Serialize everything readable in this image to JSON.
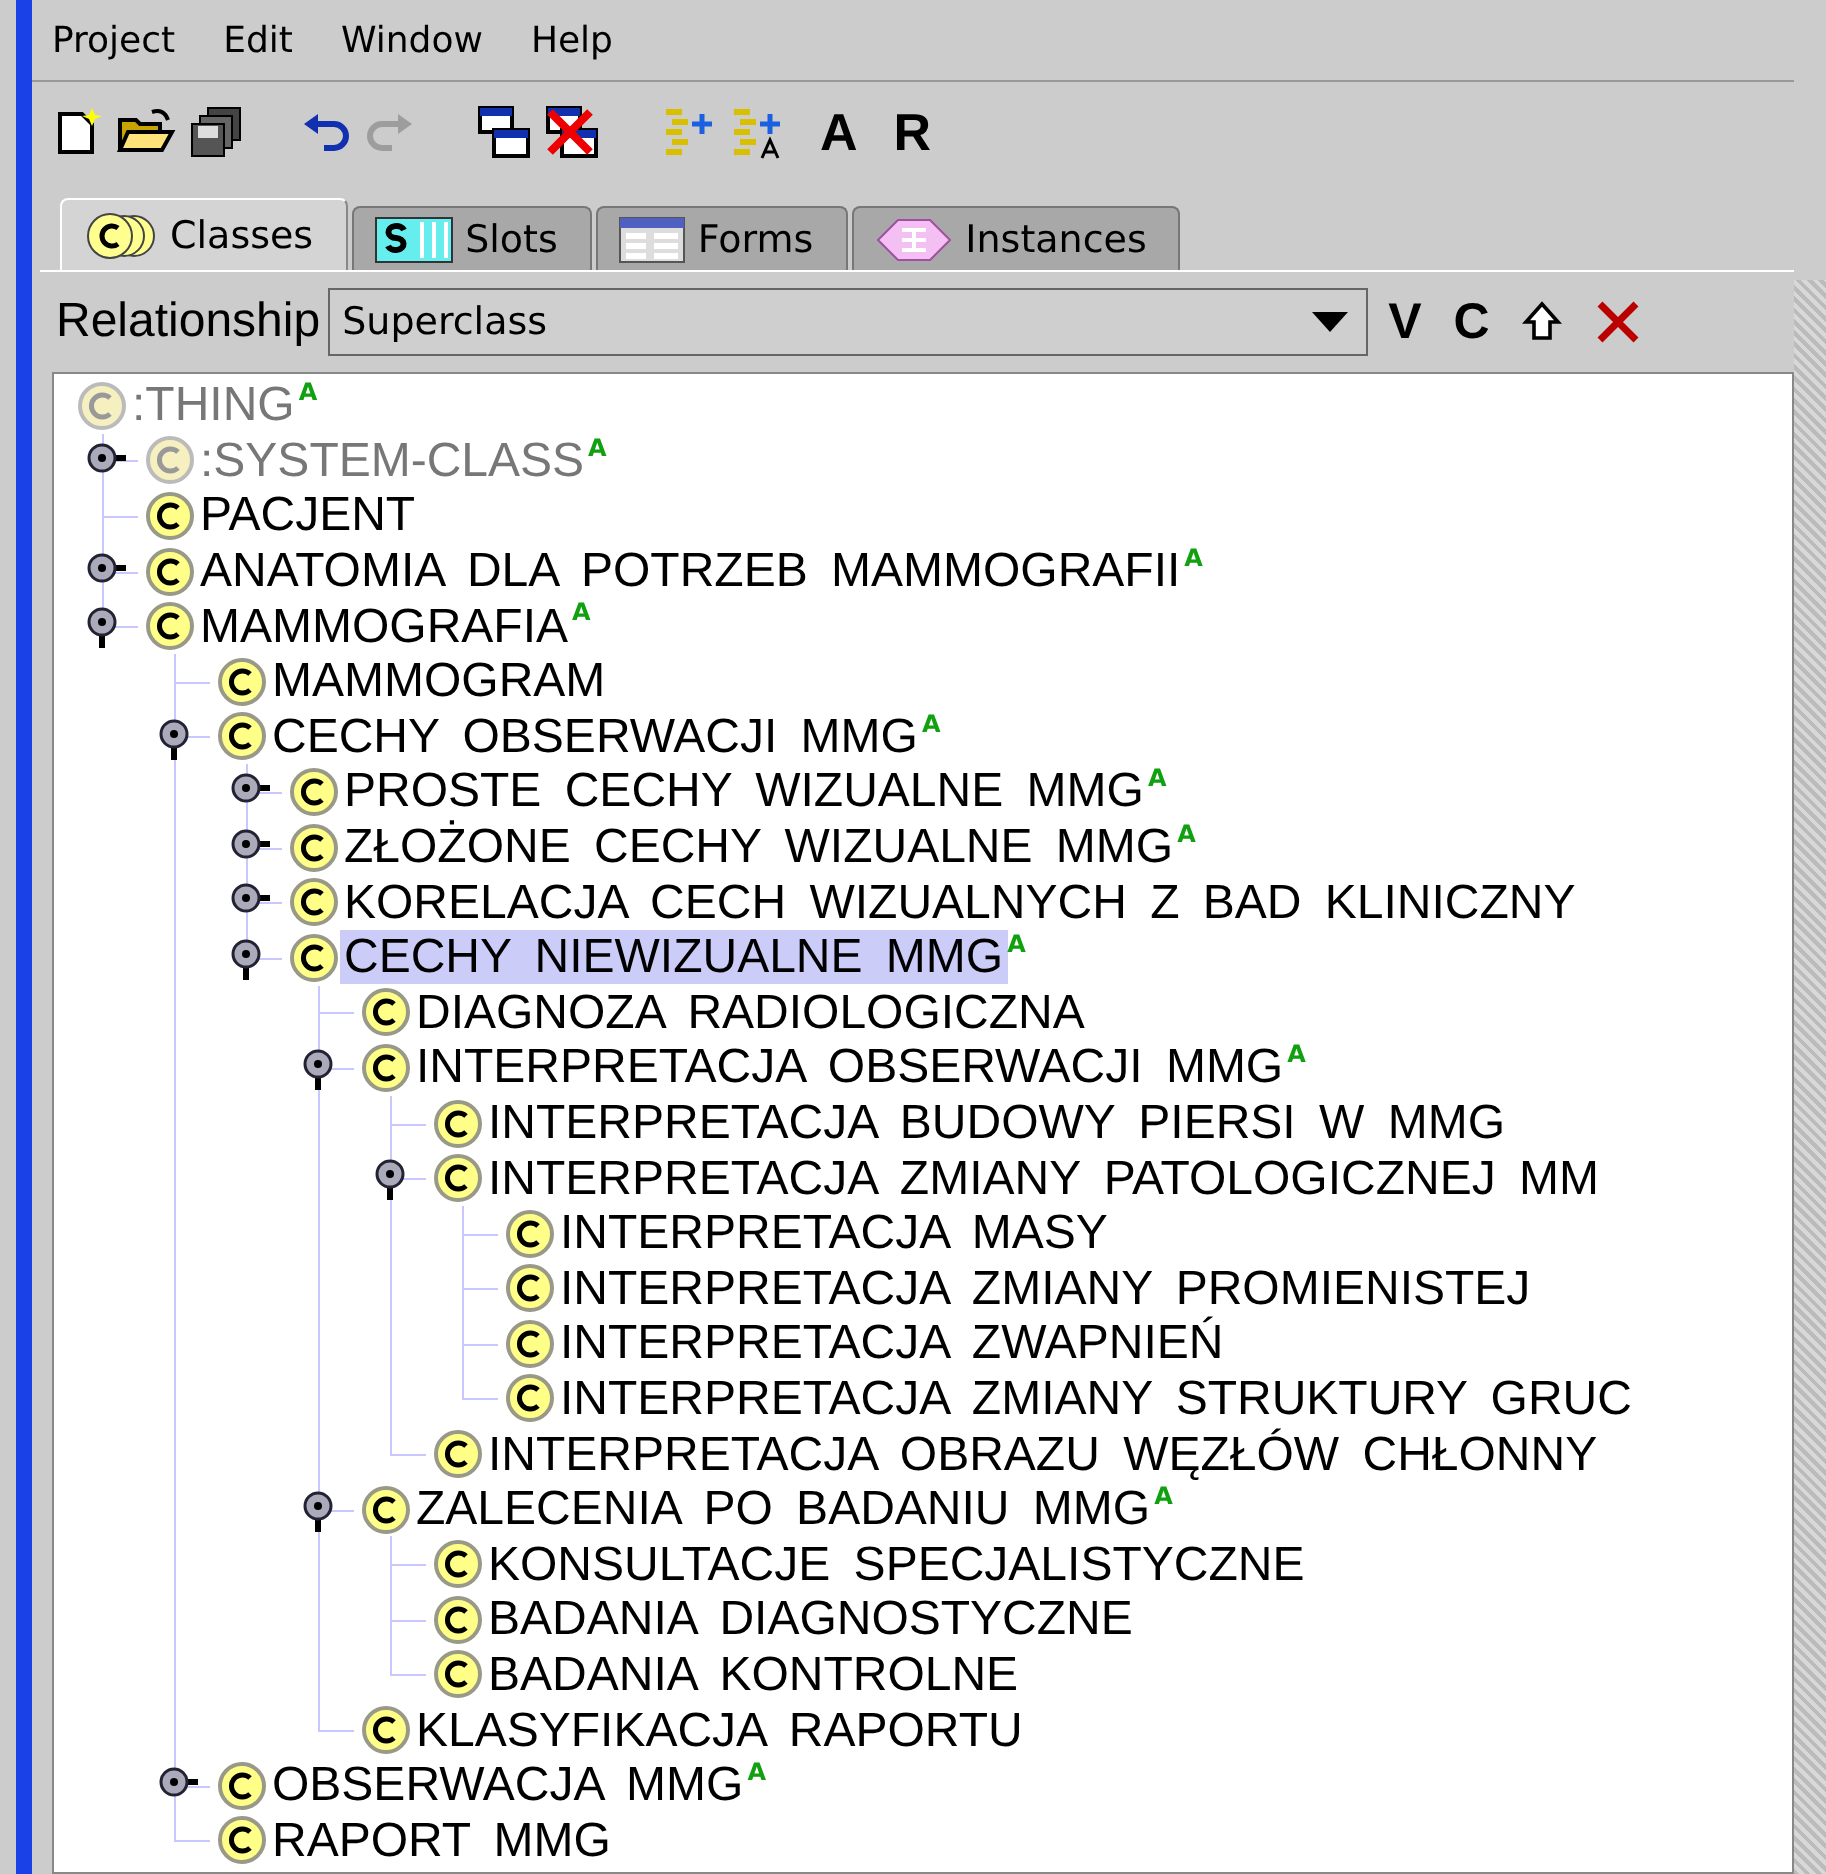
{
  "menu": [
    "Project",
    "Edit",
    "Window",
    "Help"
  ],
  "toolbar": [
    {
      "kind": "new",
      "disabled": false
    },
    {
      "kind": "open",
      "disabled": false
    },
    {
      "kind": "save",
      "disabled": false
    },
    {
      "kind": "undo",
      "disabled": false
    },
    {
      "kind": "redo",
      "disabled": true
    },
    {
      "kind": "windows",
      "disabled": false
    },
    {
      "kind": "close-windows",
      "disabled": false
    },
    {
      "kind": "add-item",
      "disabled": false
    },
    {
      "kind": "add-item-alt",
      "disabled": false
    },
    {
      "kind": "text",
      "label": "A",
      "disabled": false
    },
    {
      "kind": "text",
      "label": "R",
      "disabled": false
    }
  ],
  "tabs": [
    {
      "kind": "classes",
      "label": "Classes",
      "selected": true
    },
    {
      "kind": "slots",
      "label": "Slots",
      "selected": false
    },
    {
      "kind": "forms",
      "label": "Forms",
      "selected": false
    },
    {
      "kind": "instances",
      "label": "Instances",
      "selected": false
    }
  ],
  "relationship": {
    "label": "Relationship",
    "value": "Superclass",
    "buttons": [
      {
        "kind": "text",
        "label": "V"
      },
      {
        "kind": "text",
        "label": "C"
      },
      {
        "kind": "move-up"
      },
      {
        "kind": "delete"
      }
    ]
  },
  "tree": {
    "root": {
      "label": ":THING",
      "badge": "A",
      "system": true,
      "selected": false,
      "children": [
        {
          "label": ":SYSTEM-CLASS",
          "badge": "A",
          "system": true,
          "selected": false,
          "expanded": false
        },
        {
          "label": "PACJENT",
          "system": false,
          "selected": false
        },
        {
          "label": "ANATOMIA DLA POTRZEB MAMMOGRAFII",
          "badge": "A",
          "system": false,
          "selected": false,
          "expanded": false
        },
        {
          "label": "MAMMOGRAFIA",
          "badge": "A",
          "system": false,
          "selected": false,
          "expanded": true,
          "children": [
            {
              "label": "MAMMOGRAM",
              "system": false,
              "selected": false
            },
            {
              "label": "CECHY OBSERWACJI MMG",
              "badge": "A",
              "system": false,
              "selected": false,
              "expanded": true,
              "children": [
                {
                  "label": "PROSTE CECHY WIZUALNE MMG",
                  "badge": "A",
                  "system": false,
                  "selected": false,
                  "expanded": false
                },
                {
                  "label": "ZŁOŻONE CECHY WIZUALNE MMG",
                  "badge": "A",
                  "system": false,
                  "selected": false,
                  "expanded": false
                },
                {
                  "label": "KORELACJA CECH WIZUALNYCH Z BAD KLINICZNY",
                  "system": false,
                  "selected": false,
                  "expanded": false
                },
                {
                  "label": "CECHY NIEWIZUALNE MMG",
                  "badge": "A",
                  "system": false,
                  "selected": true,
                  "expanded": true,
                  "children": [
                    {
                      "label": "DIAGNOZA RADIOLOGICZNA",
                      "system": false,
                      "selected": false
                    },
                    {
                      "label": "INTERPRETACJA OBSERWACJI MMG",
                      "badge": "A",
                      "system": false,
                      "selected": false,
                      "expanded": true,
                      "children": [
                        {
                          "label": "INTERPRETACJA BUDOWY PIERSI W MMG",
                          "system": false,
                          "selected": false
                        },
                        {
                          "label": "INTERPRETACJA ZMIANY PATOLOGICZNEJ MM",
                          "system": false,
                          "selected": false,
                          "expanded": true,
                          "children": [
                            {
                              "label": "INTERPRETACJA MASY",
                              "system": false,
                              "selected": false
                            },
                            {
                              "label": "INTERPRETACJA ZMIANY PROMIENISTEJ",
                              "system": false,
                              "selected": false
                            },
                            {
                              "label": "INTERPRETACJA ZWAPNIEŃ",
                              "system": false,
                              "selected": false
                            },
                            {
                              "label": "INTERPRETACJA ZMIANY STRUKTURY GRUC",
                              "system": false,
                              "selected": false
                            }
                          ]
                        },
                        {
                          "label": "INTERPRETACJA OBRAZU WĘZŁÓW CHŁONNY",
                          "system": false,
                          "selected": false
                        }
                      ]
                    },
                    {
                      "label": "ZALECENIA PO BADANIU MMG",
                      "badge": "A",
                      "system": false,
                      "selected": false,
                      "expanded": true,
                      "children": [
                        {
                          "label": "KONSULTACJE SPECJALISTYCZNE",
                          "system": false,
                          "selected": false
                        },
                        {
                          "label": "BADANIA DIAGNOSTYCZNE",
                          "system": false,
                          "selected": false
                        },
                        {
                          "label": "BADANIA KONTROLNE",
                          "system": false,
                          "selected": false
                        }
                      ]
                    },
                    {
                      "label": "KLASYFIKACJA RAPORTU",
                      "system": false,
                      "selected": false
                    }
                  ]
                }
              ]
            },
            {
              "label": "OBSERWACJA MMG",
              "badge": "A",
              "system": false,
              "selected": false,
              "expanded": false
            },
            {
              "label": "RAPORT MMG",
              "system": false,
              "selected": false
            }
          ]
        }
      ]
    }
  }
}
